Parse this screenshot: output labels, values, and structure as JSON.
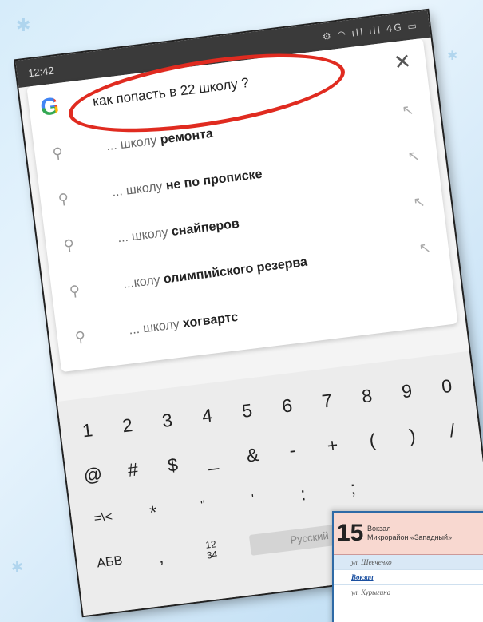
{
  "status_bar": {
    "time": "12:42",
    "icons": "⚙ ◠ ıll ıll 4G ▭"
  },
  "search": {
    "logo_letter": "G",
    "query": "как попасть в 22 школу ?",
    "clear_glyph": "✕"
  },
  "suggestions": [
    {
      "prefix": "... школу ",
      "bold": "ремонта"
    },
    {
      "prefix": "... школу ",
      "bold": "не по прописке"
    },
    {
      "prefix": "... школу ",
      "bold": "снайперов"
    },
    {
      "prefix": "...колу ",
      "bold": "олимпийского резерва"
    },
    {
      "prefix": "... школу ",
      "bold": "хогвартс"
    }
  ],
  "keyboard": {
    "row1": [
      "1",
      "2",
      "3",
      "4",
      "5",
      "6",
      "7",
      "8",
      "9",
      "0"
    ],
    "row2": [
      "@",
      "#",
      "$",
      "_",
      "&",
      "-",
      "+",
      "(",
      ")",
      "/"
    ],
    "row3": [
      "=\\<",
      "*",
      "\"",
      "'",
      ":",
      ";"
    ],
    "row4": {
      "abc": "АБВ",
      "comma": ",",
      "numpad_top": "12",
      "numpad_bottom": "34",
      "space": "Русский"
    }
  },
  "schedule": {
    "route_number": "15",
    "endpoint_a": "Вокзал",
    "endpoint_b": "Микрорайон «Западный»",
    "stops": [
      "ул. Шевченко",
      "Вокзал",
      "ул. Курыгина"
    ]
  },
  "colors": {
    "highlight": "#e02b20",
    "background": "#d6ecfa",
    "schedule_header": "#f8d8d0"
  }
}
